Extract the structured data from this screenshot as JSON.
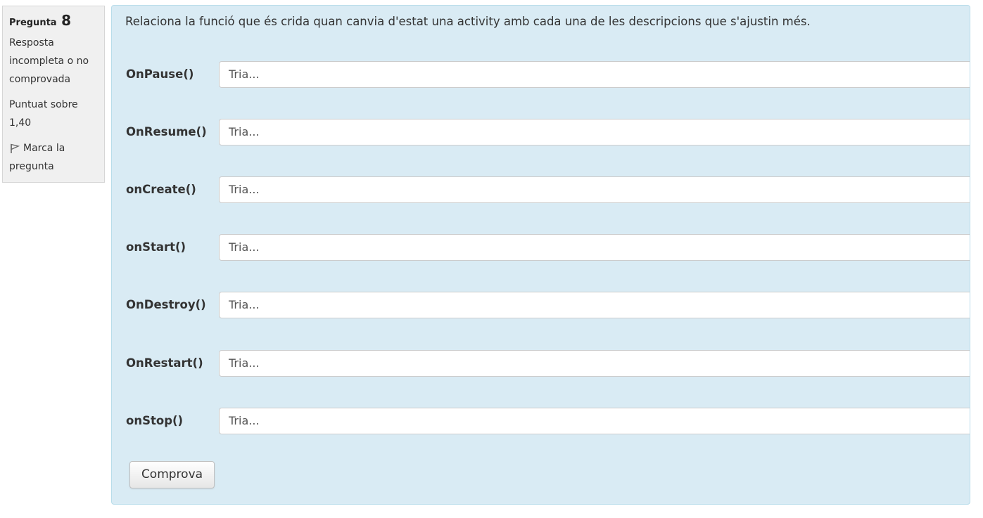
{
  "info": {
    "question_word": "Pregunta",
    "question_number": "8",
    "state": "Resposta incompleta o no comprovada",
    "grade": "Puntuat sobre 1,40",
    "flag_icon": "flag-icon",
    "flag_label": "Marca la pregunta"
  },
  "question": {
    "text": "Relaciona la funció que és crida quan canvia d'estat una activity amb cada una de les descripcions que s'ajustin més.",
    "rows": [
      {
        "label": "OnPause()",
        "selected": "Tria..."
      },
      {
        "label": "OnResume()",
        "selected": "Tria..."
      },
      {
        "label": "onCreate()",
        "selected": "Tria..."
      },
      {
        "label": "onStart()",
        "selected": "Tria..."
      },
      {
        "label": "OnDestroy()",
        "selected": "Tria..."
      },
      {
        "label": "OnRestart()",
        "selected": "Tria..."
      },
      {
        "label": "onStop()",
        "selected": "Tria..."
      }
    ],
    "check_button": "Comprova"
  },
  "colors": {
    "content_bg": "#d9ebf4",
    "info_bg": "#f0f0f0"
  }
}
